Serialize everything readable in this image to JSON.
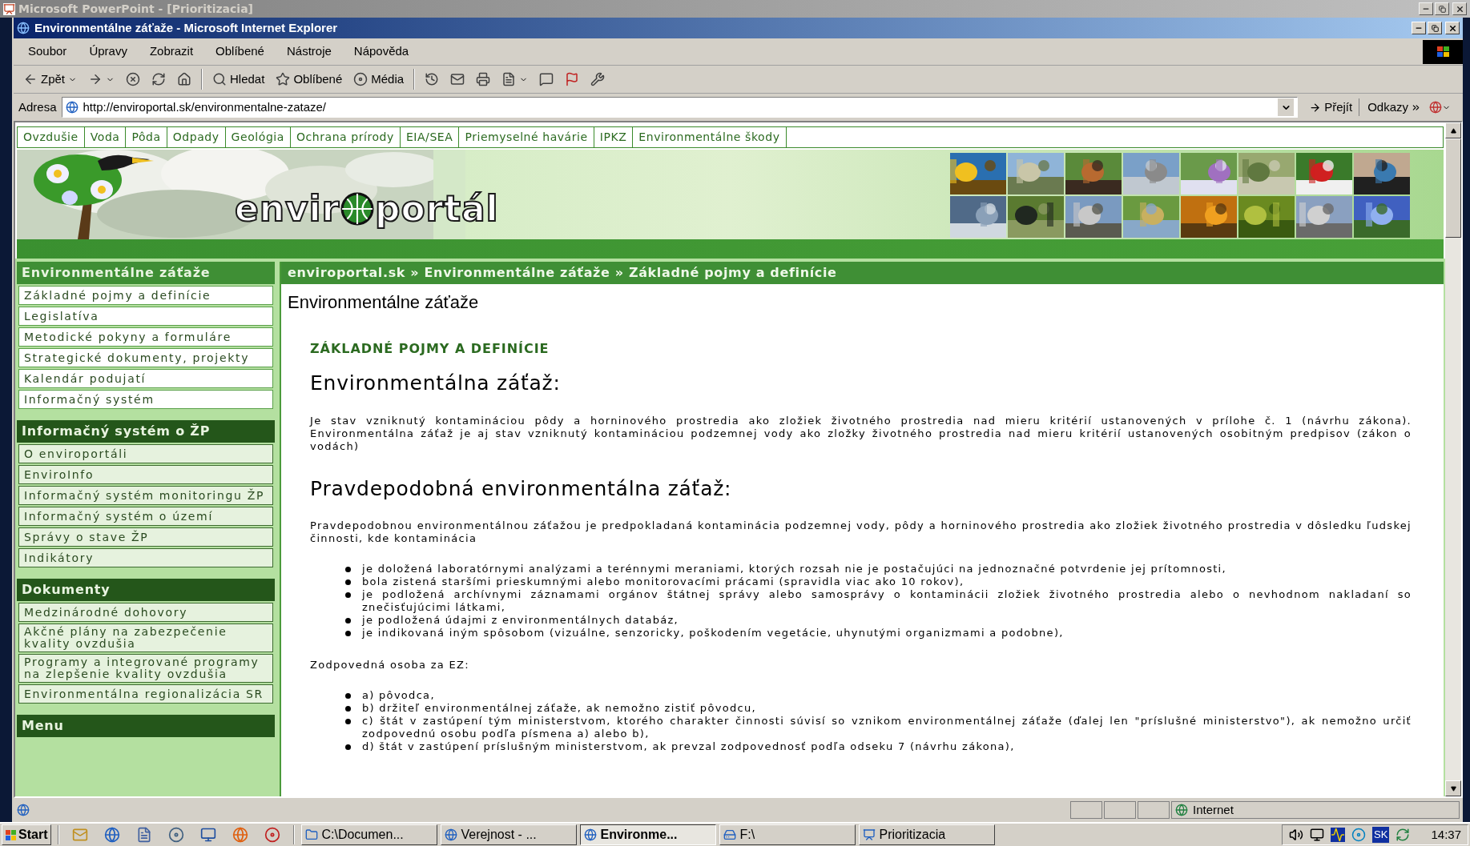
{
  "background_window": {
    "title": "Microsoft PowerPoint - [Prioritizacia]"
  },
  "window": {
    "title": "Environmentálne záťaže - Microsoft Internet Explorer"
  },
  "menu": [
    "Soubor",
    "Úpravy",
    "Zobrazit",
    "Oblíbené",
    "Nástroje",
    "Nápověda"
  ],
  "toolbar": [
    {
      "kind": "back",
      "label": "Zpět"
    },
    {
      "kind": "forward"
    },
    {
      "kind": "stop"
    },
    {
      "kind": "refresh"
    },
    {
      "kind": "home"
    },
    {
      "kind": "search",
      "label": "Hledat"
    },
    {
      "kind": "favorites",
      "label": "Oblíbené"
    },
    {
      "kind": "media",
      "label": "Média"
    },
    {
      "kind": "history"
    },
    {
      "kind": "mail"
    },
    {
      "kind": "print"
    },
    {
      "kind": "edit"
    },
    {
      "kind": "discuss"
    },
    {
      "kind": "flag"
    },
    {
      "kind": "tool"
    }
  ],
  "address": {
    "label": "Adresa",
    "value": "http://enviroportal.sk/environmentalne-zataze/",
    "go": "Přejít",
    "links": "Odkazy"
  },
  "site": {
    "nav": [
      "Ovzdušie",
      "Voda",
      "Pôda",
      "Odpady",
      "Geológia",
      "Ochrana prírody",
      "EIA/SEA",
      "Priemyselné havárie",
      "IPKZ",
      "Environmentálne škody"
    ],
    "logo": {
      "left": "envir",
      "right": "portál"
    },
    "sidebar": [
      {
        "title": "Environmentálne záťaže",
        "active": true,
        "items": [
          "Základné pojmy a definície",
          "Legislatíva",
          "Metodické pokyny a formuláre",
          "Strategické dokumenty, projekty",
          "Kalendár podujatí",
          "Informačný systém"
        ]
      },
      {
        "title": "Informačný systém o ŽP",
        "active": false,
        "items": [
          "O enviroportáli",
          "EnviroInfo",
          "Informačný systém monitoringu ŽP",
          "Informačný systém o území",
          "Správy o stave ŽP",
          "Indikátory"
        ]
      },
      {
        "title": "Dokumenty",
        "active": false,
        "items": [
          "Medzinárodné dohovory",
          "Akčné plány na zabezpečenie kvality ovzdušia",
          "Programy a integrované programy na zlepšenie kvality ovzdušia",
          "Environmentálna regionalizácia SR"
        ]
      },
      {
        "title": "Menu",
        "active": false
      }
    ],
    "breadcrumb": "enviroportal.sk » Environmentálne záťaže » Základné pojmy a definície",
    "page_title": "Environmentálne záťaže",
    "content": [
      {
        "kind": "subheading",
        "text": "ZÁKLADNÉ POJMY A DEFINÍCIE"
      },
      {
        "kind": "heading",
        "text": "Environmentálna záťaž:"
      },
      {
        "kind": "paragraph",
        "text": "Je stav vzniknutý kontamináciou pôdy a horninového prostredia ako zložiek životného prostredia nad mieru kritérií ustanovených v prílohe č. 1 (návrhu zákona). Environmentálna záťaž je aj stav vzniknutý kontamináciou podzemnej vody ako zložky životného prostredia nad mieru kritérií ustanovených osobitným predpisov (zákon o vodách)"
      },
      {
        "kind": "heading",
        "text": "Pravdepodobná environmentálna záťaž:"
      },
      {
        "kind": "paragraph",
        "text": "Pravdepodobnou environmentálnou záťažou je predpokladaná kontaminácia podzemnej vody, pôdy a horninového prostredia ako zložiek životného prostredia v dôsledku ľudskej činnosti, kde kontaminácia"
      },
      {
        "kind": "list",
        "items": [
          "je doložená laboratórnymi analýzami a terénnymi meraniami, ktorých rozsah nie je postačujúci na jednoznačné potvrdenie jej prítomnosti,",
          "bola zistená staršími prieskumnými alebo monitorovacími prácami (spravidla viac ako 10 rokov),",
          "je podložená archívnymi záznamami orgánov štátnej správy alebo samosprávy o kontaminácii zložiek životného prostredia alebo o nevhodnom nakladaní so znečisťujúcimi látkami,",
          "je podložená údajmi z environmentálnych databáz,",
          "je indikovaná iným spôsobom (vizuálne, senzoricky, poškodením vegetácie, uhynutými organizmami a podobne),"
        ]
      },
      {
        "kind": "paragraph",
        "text": "Zodpovedná osoba za EZ:"
      },
      {
        "kind": "list",
        "items": [
          "a) pôvodca,",
          "b) držiteľ environmentálnej záťaže, ak nemožno zistiť pôvodcu,",
          "c) štát v zastúpení tým ministerstvom, ktorého charakter činnosti súvisí so vznikom environmentálnej záťaže (ďalej len \"príslušné ministerstvo\"), ak nemožno určiť zodpovednú osobu podľa písmena a) alebo b),",
          "d) štát v zastúpení príslušným ministerstvom, ak prevzal zodpovednosť podľa odseku 7 (návrhu zákona),"
        ]
      }
    ]
  },
  "status_bar": {
    "zone": "Internet"
  },
  "taskbar": {
    "start": "Start",
    "tasks": [
      {
        "label": "C:\\Documen...",
        "kind": "folder",
        "selected": false
      },
      {
        "label": "Verejnost - ...",
        "kind": "browser",
        "selected": false
      },
      {
        "label": "Environme...",
        "kind": "browser",
        "selected": true
      },
      {
        "label": "F:\\",
        "kind": "drive",
        "selected": false
      },
      {
        "label": "Prioritizacia",
        "kind": "slides",
        "selected": false
      }
    ],
    "lang": "SK",
    "clock": "14:37"
  }
}
